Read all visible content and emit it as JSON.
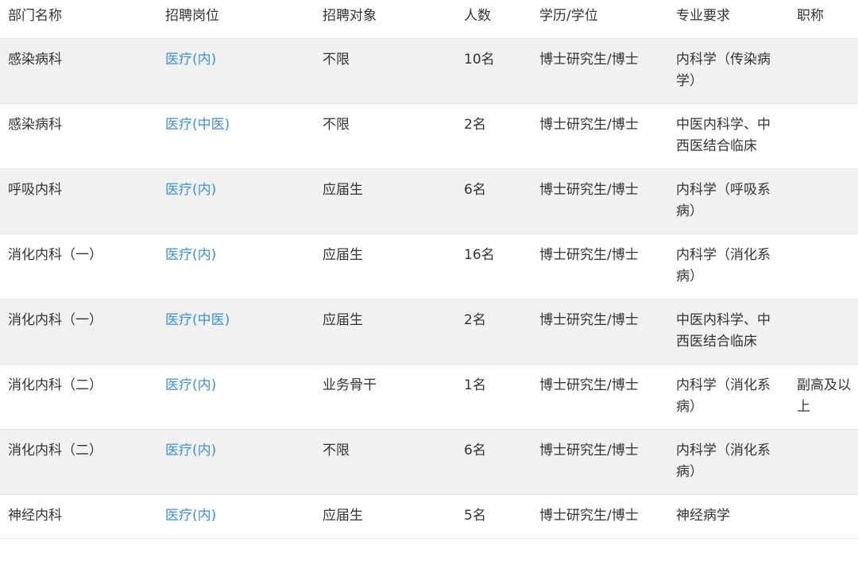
{
  "table": {
    "headers": [
      "部门名称",
      "招聘岗位",
      "招聘对象",
      "人数",
      "学历/学位",
      "专业要求",
      "职称"
    ],
    "rows": [
      [
        "感染病科",
        "医疗(内)",
        "不限",
        "10名",
        "博士研究生/博士",
        "内科学（传染病学）",
        ""
      ],
      [
        "感染病科",
        "医疗(中医)",
        "不限",
        "2名",
        "博士研究生/博士",
        "中医内科学、中西医结合临床",
        ""
      ],
      [
        "呼吸内科",
        "医疗(内)",
        "应届生",
        "6名",
        "博士研究生/博士",
        "内科学（呼吸系病）",
        ""
      ],
      [
        "消化内科（一）",
        "医疗(内)",
        "应届生",
        "16名",
        "博士研究生/博士",
        "内科学（消化系病）",
        ""
      ],
      [
        "消化内科（一）",
        "医疗(中医)",
        "应届生",
        "2名",
        "博士研究生/博士",
        "中医内科学、中西医结合临床",
        ""
      ],
      [
        "消化内科（二）",
        "医疗(内)",
        "业务骨干",
        "1名",
        "博士研究生/博士",
        "内科学（消化系病）",
        "副高及以上"
      ],
      [
        "消化内科（二）",
        "医疗(内)",
        "不限",
        "6名",
        "博士研究生/博士",
        "内科学（消化系病）",
        ""
      ],
      [
        "神经内科",
        "医疗(内)",
        "应届生",
        "5名",
        "博士研究生/博士",
        "神经病学",
        ""
      ]
    ]
  },
  "colors": {
    "link": "#3a8fd6",
    "text": "#333333",
    "stripe": "#f1f1f1",
    "border": "#e4e4e4"
  }
}
